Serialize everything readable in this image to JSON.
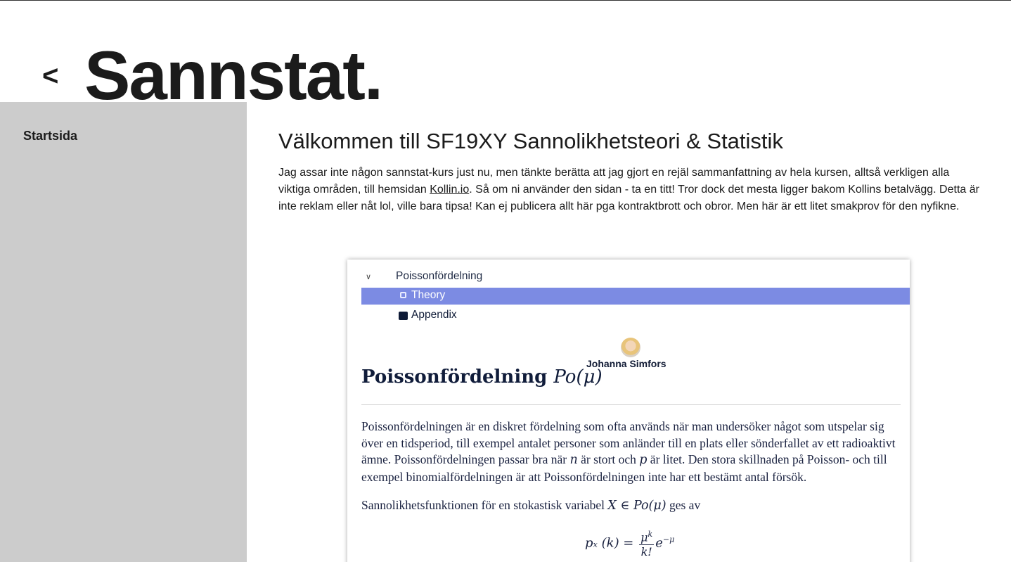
{
  "header": {
    "back_symbol": "<",
    "site_title": "Sannstat."
  },
  "sidebar": {
    "items": [
      {
        "label": "Startsida"
      }
    ]
  },
  "main": {
    "heading": "Välkommen till SF19XY Sannolikhetsteori & Statistik",
    "intro_before_link": "Jag assar inte någon sannstat-kurs just nu, men tänkte berätta att jag gjort en rejäl sammanfattning av hela kursen, alltså verkligen alla viktiga områden, till hemsidan ",
    "intro_link": "Kollin.io",
    "intro_after_link": ". Så om ni använder den sidan - ta en titt! Tror dock det mesta ligger bakom Kollins betalvägg. Detta är inte reklam eller nåt lol, ville bara tipsa! Kan ej publicera allt här pga kontraktbrott och obror. Men här är ett litet smakprov för den nyfikne."
  },
  "screenshot": {
    "nav": {
      "parent": "Poissonfördelning",
      "active": "Theory",
      "child": "Appendix"
    },
    "author": "Johanna Simfors",
    "title_text": "Poissonfördelning",
    "title_math": "Po(μ)",
    "paragraph_1": "Poissonfördelningen är en diskret fördelning som ofta används när man undersöker något som utspelar sig över en tidsperiod, till exempel antalet personer som anländer till en plats eller sönderfallet av ett radioaktivt ämne. Poissonfördelningen passar bra när ",
    "var_n": "n",
    "paragraph_1b": " är stort och ",
    "var_p": "p",
    "paragraph_1c": " är litet. Den stora skillnaden på Poisson- och till exempel binomialfördelningen är att Poissonfördelningen inte har ett bestämt antal försök.",
    "paragraph_2": "Sannolikhetsfunktionen för en stokastisk variabel ",
    "paragraph_2_math": "X ∈ Po(μ)",
    "paragraph_2_end": " ges av",
    "formula_lhs": "pₓ (k) =",
    "formula_num": "μ",
    "formula_num_exp": "k",
    "formula_den": "k!",
    "formula_rhs": "e",
    "formula_rhs_exp": "−μ"
  }
}
